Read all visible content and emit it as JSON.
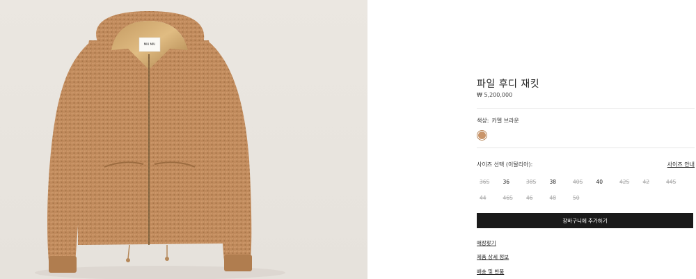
{
  "product": {
    "title": "파일 후디 재킷",
    "price": "₩ 5,200,000",
    "color_label": "색상:",
    "color_value": "카멜 브라운",
    "swatch_color": "#c9956a",
    "size_label": "사이즈 선택 (이탈리아):",
    "size_guide": "사이즈 안내",
    "sizes": [
      {
        "label": "36S",
        "available": false
      },
      {
        "label": "36",
        "available": true
      },
      {
        "label": "38S",
        "available": false
      },
      {
        "label": "38",
        "available": true
      },
      {
        "label": "40S",
        "available": false
      },
      {
        "label": "40",
        "available": true
      },
      {
        "label": "42S",
        "available": false
      },
      {
        "label": "42",
        "available": false
      },
      {
        "label": "44S",
        "available": false
      },
      {
        "label": "44",
        "available": false
      },
      {
        "label": "46S",
        "available": false
      },
      {
        "label": "46",
        "available": false
      },
      {
        "label": "48",
        "available": false
      },
      {
        "label": "50",
        "available": false
      }
    ],
    "add_to_cart": "장바구니에 추가하기",
    "links": [
      "매장찾기",
      "제품 상세 정보",
      "배송 및 반품"
    ]
  },
  "image": {
    "label_text": "MIU MIU",
    "background_color": "#e9e5df",
    "jacket_color": "#c08a5c"
  }
}
